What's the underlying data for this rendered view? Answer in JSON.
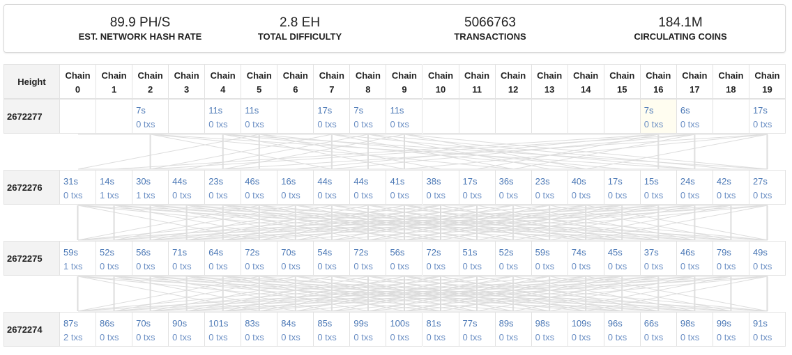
{
  "stats": [
    {
      "value": "89.9 PH/S",
      "label": "EST. NETWORK HASH RATE"
    },
    {
      "value": "2.8 EH",
      "label": "TOTAL DIFFICULTY"
    },
    {
      "value": "5066763",
      "label": "TRANSACTIONS"
    },
    {
      "value": "184.1M",
      "label": "CIRCULATING COINS"
    }
  ],
  "header": {
    "height_label": "Height",
    "chain_prefix": "Chain",
    "chains": [
      "0",
      "1",
      "2",
      "3",
      "4",
      "5",
      "6",
      "7",
      "8",
      "9",
      "10",
      "11",
      "12",
      "13",
      "14",
      "15",
      "16",
      "17",
      "18",
      "19"
    ]
  },
  "rows": [
    {
      "height": "2672277",
      "cells": [
        null,
        null,
        {
          "time": "7s",
          "txs": "0 txs"
        },
        null,
        {
          "time": "11s",
          "txs": "0 txs"
        },
        {
          "time": "11s",
          "txs": "0 txs"
        },
        null,
        {
          "time": "17s",
          "txs": "0 txs"
        },
        {
          "time": "7s",
          "txs": "0 txs"
        },
        {
          "time": "11s",
          "txs": "0 txs"
        },
        null,
        null,
        null,
        null,
        null,
        null,
        {
          "time": "7s",
          "txs": "0 txs",
          "highlight": true
        },
        {
          "time": "6s",
          "txs": "0 txs"
        },
        null,
        {
          "time": "17s",
          "txs": "0 txs"
        }
      ]
    },
    {
      "height": "2672276",
      "cells": [
        {
          "time": "31s",
          "txs": "0 txs"
        },
        {
          "time": "14s",
          "txs": "1 txs"
        },
        {
          "time": "30s",
          "txs": "1 txs"
        },
        {
          "time": "44s",
          "txs": "0 txs"
        },
        {
          "time": "23s",
          "txs": "0 txs"
        },
        {
          "time": "46s",
          "txs": "0 txs"
        },
        {
          "time": "16s",
          "txs": "0 txs"
        },
        {
          "time": "44s",
          "txs": "0 txs"
        },
        {
          "time": "44s",
          "txs": "0 txs"
        },
        {
          "time": "41s",
          "txs": "0 txs"
        },
        {
          "time": "38s",
          "txs": "0 txs"
        },
        {
          "time": "17s",
          "txs": "0 txs"
        },
        {
          "time": "36s",
          "txs": "0 txs"
        },
        {
          "time": "23s",
          "txs": "0 txs"
        },
        {
          "time": "40s",
          "txs": "0 txs"
        },
        {
          "time": "17s",
          "txs": "0 txs"
        },
        {
          "time": "15s",
          "txs": "0 txs"
        },
        {
          "time": "24s",
          "txs": "0 txs"
        },
        {
          "time": "42s",
          "txs": "0 txs"
        },
        {
          "time": "27s",
          "txs": "0 txs"
        }
      ]
    },
    {
      "height": "2672275",
      "cells": [
        {
          "time": "59s",
          "txs": "1 txs"
        },
        {
          "time": "52s",
          "txs": "0 txs"
        },
        {
          "time": "56s",
          "txs": "0 txs"
        },
        {
          "time": "71s",
          "txs": "0 txs"
        },
        {
          "time": "64s",
          "txs": "0 txs"
        },
        {
          "time": "72s",
          "txs": "0 txs"
        },
        {
          "time": "70s",
          "txs": "0 txs"
        },
        {
          "time": "54s",
          "txs": "0 txs"
        },
        {
          "time": "72s",
          "txs": "0 txs"
        },
        {
          "time": "56s",
          "txs": "0 txs"
        },
        {
          "time": "72s",
          "txs": "0 txs"
        },
        {
          "time": "51s",
          "txs": "0 txs"
        },
        {
          "time": "52s",
          "txs": "0 txs"
        },
        {
          "time": "59s",
          "txs": "0 txs"
        },
        {
          "time": "74s",
          "txs": "0 txs"
        },
        {
          "time": "45s",
          "txs": "0 txs"
        },
        {
          "time": "37s",
          "txs": "0 txs"
        },
        {
          "time": "46s",
          "txs": "0 txs"
        },
        {
          "time": "79s",
          "txs": "0 txs"
        },
        {
          "time": "49s",
          "txs": "0 txs"
        }
      ]
    },
    {
      "height": "2672274",
      "cells": [
        {
          "time": "87s",
          "txs": "2 txs"
        },
        {
          "time": "86s",
          "txs": "0 txs"
        },
        {
          "time": "70s",
          "txs": "0 txs"
        },
        {
          "time": "90s",
          "txs": "0 txs"
        },
        {
          "time": "101s",
          "txs": "0 txs"
        },
        {
          "time": "83s",
          "txs": "0 txs"
        },
        {
          "time": "84s",
          "txs": "0 txs"
        },
        {
          "time": "85s",
          "txs": "0 txs"
        },
        {
          "time": "99s",
          "txs": "0 txs"
        },
        {
          "time": "100s",
          "txs": "0 txs"
        },
        {
          "time": "81s",
          "txs": "0 txs"
        },
        {
          "time": "77s",
          "txs": "0 txs"
        },
        {
          "time": "89s",
          "txs": "0 txs"
        },
        {
          "time": "98s",
          "txs": "0 txs"
        },
        {
          "time": "109s",
          "txs": "0 txs"
        },
        {
          "time": "96s",
          "txs": "0 txs"
        },
        {
          "time": "66s",
          "txs": "0 txs"
        },
        {
          "time": "98s",
          "txs": "0 txs"
        },
        {
          "time": "99s",
          "txs": "0 txs"
        },
        {
          "time": "91s",
          "txs": "0 txs"
        }
      ]
    }
  ],
  "colors": {
    "link_text": "#4a77b5",
    "border": "#e2e2e2",
    "header_bg": "#f3f3f3",
    "connector": "#dcdcdc"
  }
}
